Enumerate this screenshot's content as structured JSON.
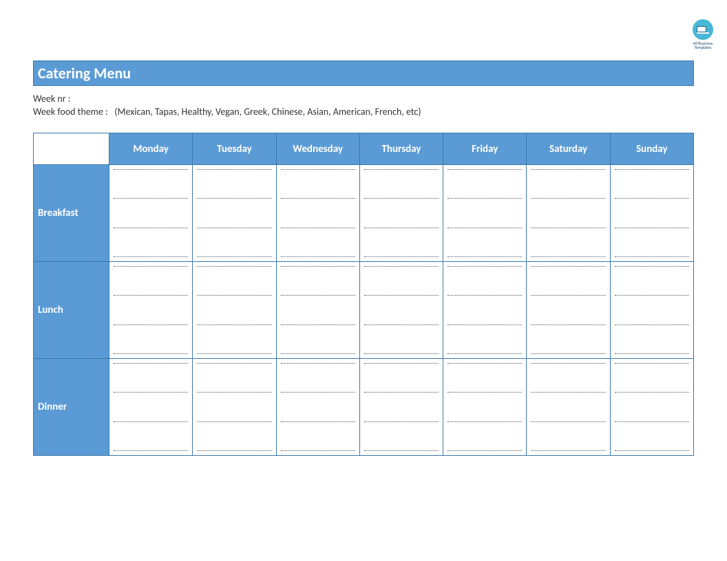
{
  "logo": {
    "line1": "All Business",
    "line2": "Templates"
  },
  "title": "Catering Menu",
  "meta": {
    "week_nr_label": "Week nr :",
    "week_nr_value": "",
    "theme_label": "Week food theme :",
    "theme_value": "(Mexican, Tapas, Healthy, Vegan, Greek, Chinese, Asian, American, French, etc)"
  },
  "days": [
    "Monday",
    "Tuesday",
    "Wednesday",
    "Thursday",
    "Friday",
    "Saturday",
    "Sunday"
  ],
  "meals": [
    "Breakfast",
    "Lunch",
    "Dinner"
  ]
}
